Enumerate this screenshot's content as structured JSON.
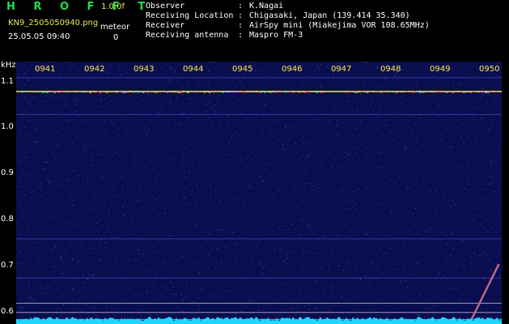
{
  "header": {
    "brand": "H R O F F T",
    "version": "1.0.0f",
    "filename": "KN9_2505050940.png",
    "counter_label": "meteor",
    "datetime": "25.05.05 09:40",
    "counter_value": "0"
  },
  "info": [
    {
      "key": "Observer",
      "value": "K.Nagai"
    },
    {
      "key": "Receiving Location",
      "value": "Chigasaki, Japan (139.414 35.340)"
    },
    {
      "key": "Receiver",
      "value": "AirSpy mini (Miakejima VOR 108.65MHz)"
    },
    {
      "key": "Receiving antenna",
      "value": "Maspro FM-3"
    }
  ],
  "info_separator": ":",
  "colors": {
    "background": "#000000",
    "plot_bg": "#0a0e4e",
    "brand": "#22e04a",
    "time_labels": "#ffe84a",
    "noise_floor": "#1fd6ff",
    "carrier": "#e8d040"
  },
  "chart_data": {
    "type": "heatmap",
    "unit_label": "kHz",
    "y_ticks": [
      "1.1",
      "1.0",
      "0.9",
      "0.8",
      "0.7",
      "0.6"
    ],
    "ylim": [
      0.575,
      1.145
    ],
    "x_ticks": [
      "0941",
      "0942",
      "0943",
      "0944",
      "0945",
      "0946",
      "0947",
      "0948",
      "0949",
      "0950"
    ],
    "carrier_khz": 1.08,
    "reference_lines_khz": [
      0.62,
      0.6,
      0.585
    ],
    "meteor_echo": {
      "start_time": "0949.6",
      "end_time": "0950.2",
      "start_khz": 0.575,
      "end_khz": 0.705
    }
  }
}
